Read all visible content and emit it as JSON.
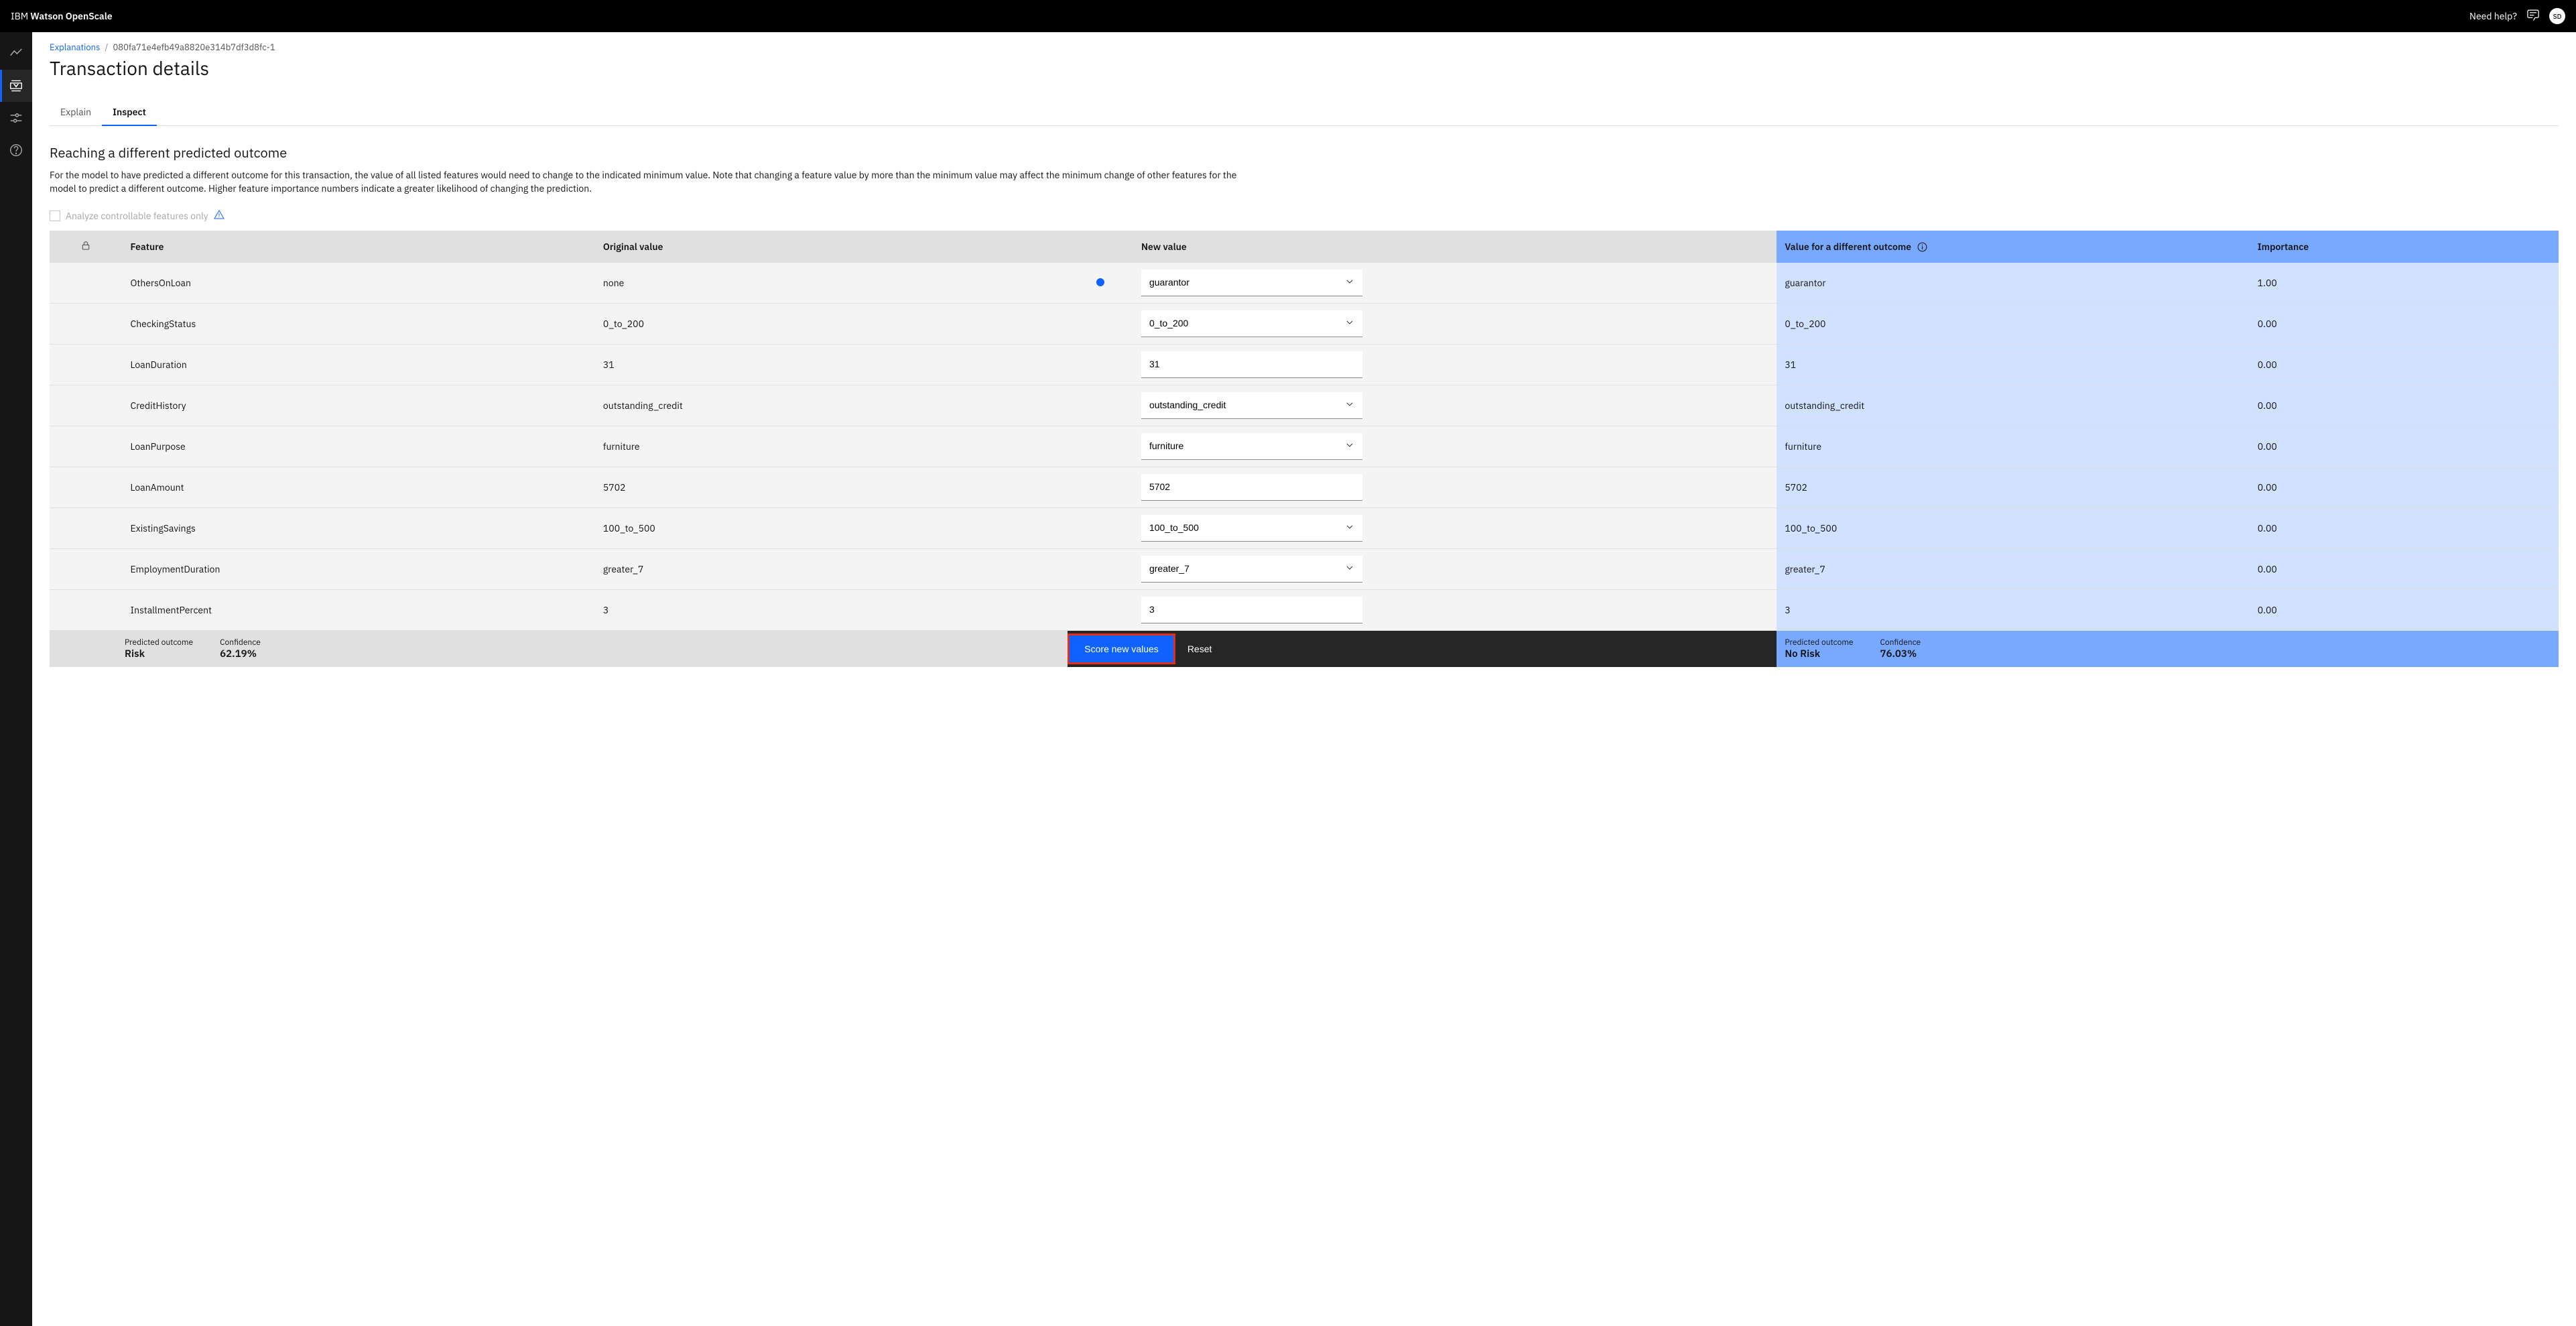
{
  "header": {
    "brand_prefix": "IBM ",
    "brand_strong": "Watson OpenScale",
    "help_label": "Need help?",
    "avatar_initials": "SD"
  },
  "breadcrumb": {
    "link": "Explanations",
    "separator": "/",
    "current": "080fa71e4efb49a8820e314b7df3d8fc-1"
  },
  "page_title": "Transaction details",
  "tabs": {
    "explain": "Explain",
    "inspect": "Inspect"
  },
  "section": {
    "title": "Reaching a different predicted outcome",
    "description": "For the model to have predicted a different outcome for this transaction, the value of all listed features would need to change to the indicated minimum value. Note that changing a feature value by more than the minimum value may affect the minimum change of other features for the model to predict a different outcome. Higher feature importance numbers indicate a greater likelihood of changing the prediction.",
    "checkbox_label": "Analyze controllable features only"
  },
  "table": {
    "headers": {
      "feature": "Feature",
      "original": "Original value",
      "newval": "New value",
      "valdiff": "Value for a different outcome",
      "importance": "Importance"
    },
    "rows": [
      {
        "feature": "OthersOnLoan",
        "original": "none",
        "newval": "guarantor",
        "is_select": true,
        "changed": true,
        "valdiff": "guarantor",
        "importance": "1.00"
      },
      {
        "feature": "CheckingStatus",
        "original": "0_to_200",
        "newval": "0_to_200",
        "is_select": true,
        "changed": false,
        "valdiff": "0_to_200",
        "importance": "0.00"
      },
      {
        "feature": "LoanDuration",
        "original": "31",
        "newval": "31",
        "is_select": false,
        "changed": false,
        "valdiff": "31",
        "importance": "0.00"
      },
      {
        "feature": "CreditHistory",
        "original": "outstanding_credit",
        "newval": "outstanding_credit",
        "is_select": true,
        "changed": false,
        "valdiff": "outstanding_credit",
        "importance": "0.00"
      },
      {
        "feature": "LoanPurpose",
        "original": "furniture",
        "newval": "furniture",
        "is_select": true,
        "changed": false,
        "valdiff": "furniture",
        "importance": "0.00"
      },
      {
        "feature": "LoanAmount",
        "original": "5702",
        "newval": "5702",
        "is_select": false,
        "changed": false,
        "valdiff": "5702",
        "importance": "0.00"
      },
      {
        "feature": "ExistingSavings",
        "original": "100_to_500",
        "newval": "100_to_500",
        "is_select": true,
        "changed": false,
        "valdiff": "100_to_500",
        "importance": "0.00"
      },
      {
        "feature": "EmploymentDuration",
        "original": "greater_7",
        "newval": "greater_7",
        "is_select": true,
        "changed": false,
        "valdiff": "greater_7",
        "importance": "0.00"
      },
      {
        "feature": "InstallmentPercent",
        "original": "3",
        "newval": "3",
        "is_select": false,
        "changed": false,
        "valdiff": "3",
        "importance": "0.00"
      }
    ],
    "summary": {
      "left": {
        "predicted_label": "Predicted outcome",
        "predicted_value": "Risk",
        "confidence_label": "Confidence",
        "confidence_value": "62.19%"
      },
      "score_btn": "Score new values",
      "reset_btn": "Reset",
      "right": {
        "predicted_label": "Predicted outcome",
        "predicted_value": "No Risk",
        "confidence_label": "Confidence",
        "confidence_value": "76.03%"
      }
    }
  }
}
